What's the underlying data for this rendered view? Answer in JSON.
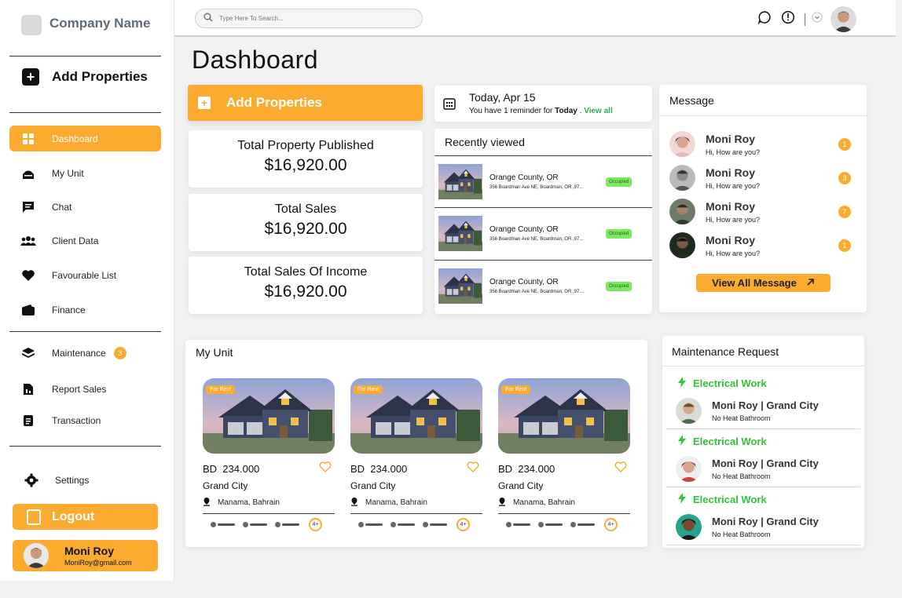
{
  "sidebar": {
    "company_name": "Company Name",
    "add_properties_label": "Add Properties",
    "items": [
      {
        "label": "Dashboard",
        "icon": "dashboard-icon",
        "active": true
      },
      {
        "label": "My Unit",
        "icon": "home-icon"
      },
      {
        "label": "Chat",
        "icon": "chat-icon"
      },
      {
        "label": "Client Data",
        "icon": "users-icon"
      },
      {
        "label": "Favourable List",
        "icon": "heart-icon"
      },
      {
        "label": "Finance",
        "icon": "wallet-icon"
      },
      {
        "label": "Maintenance",
        "icon": "layers-icon",
        "badge": "3"
      },
      {
        "label": "Report Sales",
        "icon": "report-icon"
      },
      {
        "label": "Transaction",
        "icon": "receipt-icon"
      }
    ],
    "settings_label": "Settings",
    "logout_label": "Logout",
    "profile": {
      "name": "Moni Roy",
      "email": "MoniRoy@gmail.com"
    }
  },
  "topbar": {
    "search_placeholder": "Type Here To Search..."
  },
  "page": {
    "title": "Dashboard",
    "add_properties_label": "Add Properties"
  },
  "stats": [
    {
      "label": "Total Property Published",
      "value": "$16,920.00"
    },
    {
      "label": "Total Sales",
      "value": "$16,920.00"
    },
    {
      "label": "Total Sales Of Income",
      "value": "$16,920.00"
    }
  ],
  "reminder": {
    "date": "Today, Apr 15",
    "text_prefix": "You have 1 reminder for",
    "text_bold": "Today",
    "text_sep": ".",
    "link": "View all"
  },
  "recently_viewed": {
    "title": "Recently viewed",
    "rows": [
      {
        "city": "Orange County, OR",
        "address": "356 Boardman Ave NE, Boardman, OR ,97...",
        "status": "Occupied"
      },
      {
        "city": "Orange County, OR",
        "address": "356 Boardman Ave NE, Boardman, OR ,97...",
        "status": "Occupied"
      },
      {
        "city": "Orange County, OR",
        "address": "356 Boardman Ave NE, Boardman, OR ,97...",
        "status": "Occupied"
      }
    ]
  },
  "messages": {
    "title": "Message",
    "items": [
      {
        "name": "Moni Roy",
        "text": "Hi, How are you?",
        "count": "1"
      },
      {
        "name": "Moni Roy",
        "text": "Hi, How are you?",
        "count": "3"
      },
      {
        "name": "Moni Roy",
        "text": "Hi, How are you?",
        "count": "7"
      },
      {
        "name": "Moni Roy",
        "text": "Hi, How are you?",
        "count": "1"
      }
    ],
    "view_all_label": "View All Message"
  },
  "my_unit": {
    "title": "My Unit",
    "units": [
      {
        "tag": "For Rent",
        "currency": "BD",
        "price": "234.000",
        "city": "Grand City",
        "location": "Manama, Bahrain",
        "more": "4+"
      },
      {
        "tag": "For Rent",
        "currency": "BD",
        "price": "234.000",
        "city": "Grand City",
        "location": "Manama, Bahrain",
        "more": "4+"
      },
      {
        "tag": "For Rent",
        "currency": "BD",
        "price": "234.000",
        "city": "Grand City",
        "location": "Manama, Bahrain",
        "more": "4+"
      }
    ]
  },
  "maintenance": {
    "title": "Maintenance Request",
    "items": [
      {
        "category": "Electrical Work",
        "who": "Moni Roy | Grand City",
        "issue": "No Heat Bathroom"
      },
      {
        "category": "Electrical Work",
        "who": "Moni Roy | Grand City",
        "issue": "No Heat Bathroom"
      },
      {
        "category": "Electrical Work",
        "who": "Moni Roy | Grand City",
        "issue": "No Heat Bathroom"
      }
    ]
  },
  "colors": {
    "accent": "#fbab2f",
    "green": "#34c13c",
    "occupied": "#7ee85f"
  }
}
